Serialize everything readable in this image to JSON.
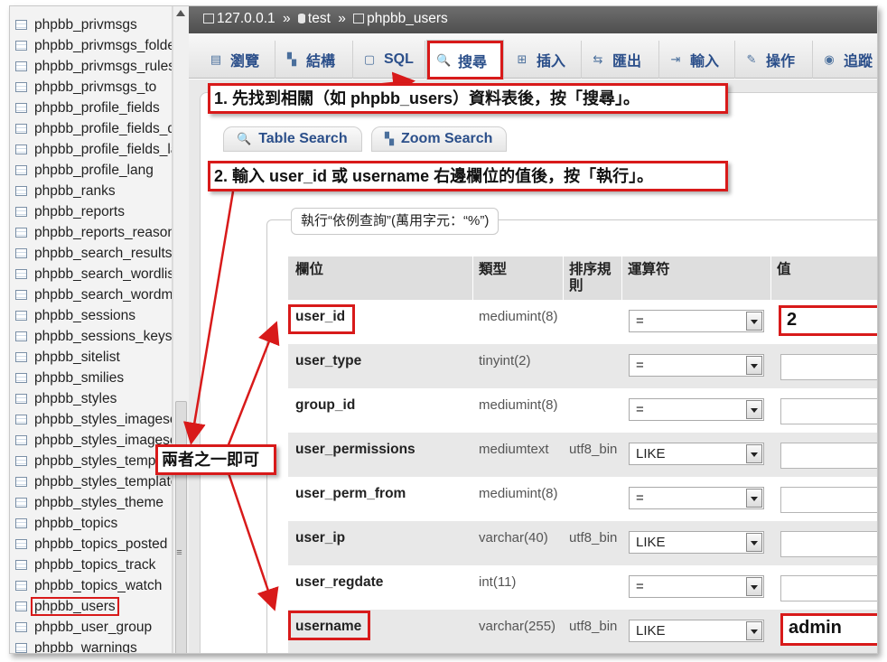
{
  "sidebar": {
    "tables": [
      "phpbb_privmsgs",
      "phpbb_privmsgs_folder",
      "phpbb_privmsgs_rules",
      "phpbb_privmsgs_to",
      "phpbb_profile_fields",
      "phpbb_profile_fields_data",
      "phpbb_profile_fields_lang",
      "phpbb_profile_lang",
      "phpbb_ranks",
      "phpbb_reports",
      "phpbb_reports_reasons",
      "phpbb_search_results",
      "phpbb_search_wordlist",
      "phpbb_search_wordmatch",
      "phpbb_sessions",
      "phpbb_sessions_keys",
      "phpbb_sitelist",
      "phpbb_smilies",
      "phpbb_styles",
      "phpbb_styles_imageset",
      "phpbb_styles_imageset_data",
      "phpbb_styles_template",
      "phpbb_styles_template_data",
      "phpbb_styles_theme",
      "phpbb_topics",
      "phpbb_topics_posted",
      "phpbb_topics_track",
      "phpbb_topics_watch",
      "phpbb_users",
      "phpbb_user_group",
      "phpbb_warnings"
    ],
    "active_table": "phpbb_users"
  },
  "breadcrumb": {
    "server": "127.0.0.1",
    "sep": "»",
    "database": "test",
    "table": "phpbb_users"
  },
  "tabs": [
    {
      "label": "瀏覽",
      "icon": "browse-icon"
    },
    {
      "label": "結構",
      "icon": "structure-icon"
    },
    {
      "label": "SQL",
      "icon": "sql-icon"
    },
    {
      "label": "搜尋",
      "icon": "search-icon"
    },
    {
      "label": "插入",
      "icon": "insert-icon"
    },
    {
      "label": "匯出",
      "icon": "export-icon"
    },
    {
      "label": "輸入",
      "icon": "import-icon"
    },
    {
      "label": "操作",
      "icon": "operations-icon"
    },
    {
      "label": "追蹤",
      "icon": "tracking-icon"
    }
  ],
  "subtabs": [
    {
      "label": "Table Search"
    },
    {
      "label": "Zoom Search"
    }
  ],
  "legend": "執行“依例查詢”(萬用字元：“%”)",
  "table": {
    "headers": {
      "field": "欄位",
      "type": "類型",
      "collation": "排序規則",
      "operator": "運算符",
      "value": "值"
    },
    "rows": [
      {
        "field": "user_id",
        "type": "mediumint(8)",
        "collation": "",
        "operator": "=",
        "value": "2"
      },
      {
        "field": "user_type",
        "type": "tinyint(2)",
        "collation": "",
        "operator": "=",
        "value": ""
      },
      {
        "field": "group_id",
        "type": "mediumint(8)",
        "collation": "",
        "operator": "=",
        "value": ""
      },
      {
        "field": "user_permissions",
        "type": "mediumtext",
        "collation": "utf8_bin",
        "operator": "LIKE",
        "value": ""
      },
      {
        "field": "user_perm_from",
        "type": "mediumint(8)",
        "collation": "",
        "operator": "=",
        "value": ""
      },
      {
        "field": "user_ip",
        "type": "varchar(40)",
        "collation": "utf8_bin",
        "operator": "LIKE",
        "value": ""
      },
      {
        "field": "user_regdate",
        "type": "int(11)",
        "collation": "",
        "operator": "=",
        "value": ""
      },
      {
        "field": "username",
        "type": "varchar(255)",
        "collation": "utf8_bin",
        "operator": "LIKE",
        "value": "admin"
      }
    ]
  },
  "annotations": {
    "step1": "1. 先找到相關（如 phpbb_users）資料表後，按「搜尋」。",
    "step2": "2. 輸入 user_id 或 username 右邊欄位的值後，按「執行」。",
    "either": "兩者之一即可"
  },
  "colors": {
    "highlight": "#d81a1a",
    "link": "#2b4f8a",
    "breadcrumb_bg": "#5a5a5a"
  }
}
